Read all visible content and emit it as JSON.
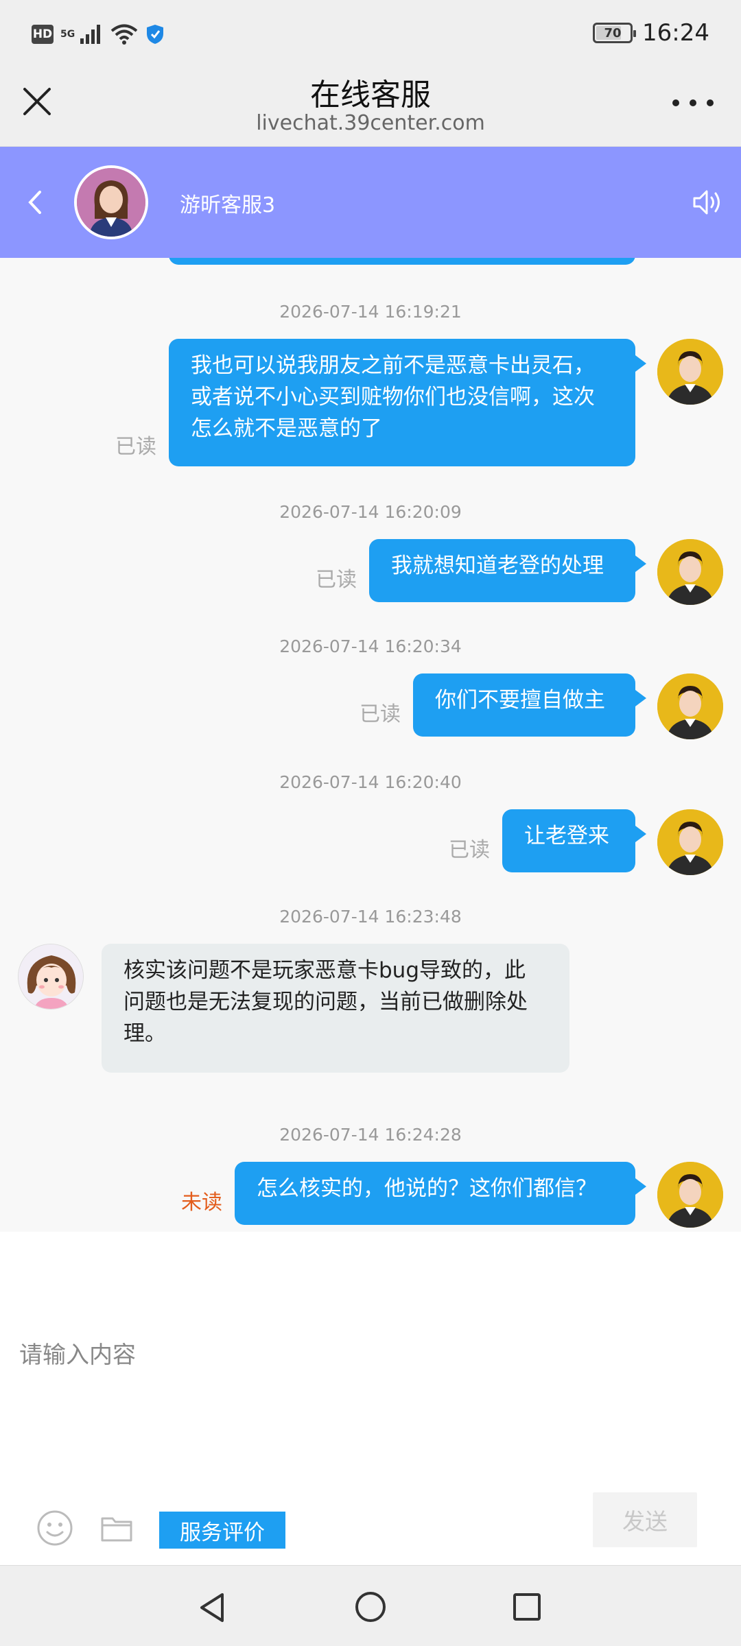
{
  "status_bar": {
    "network_label": "5G",
    "hd_label": "HD",
    "battery": "70",
    "time": "16:24"
  },
  "title_bar": {
    "title": "在线客服",
    "url": "livechat.39center.com"
  },
  "chat_header": {
    "agent_name": "游昕客服3"
  },
  "messages": [
    {
      "timestamp": "2026-07-14 16:19:21",
      "direction": "out",
      "text_lines": [
        "我也可以说我朋友之前不是恶意卡出灵石，",
        "或者说不小心买到赃物你们也没信啊，这次",
        "怎么就不是恶意的了"
      ],
      "status": "已读"
    },
    {
      "timestamp": "2026-07-14 16:20:09",
      "direction": "out",
      "text_lines": [
        "我就想知道老登的处理"
      ],
      "status": "已读"
    },
    {
      "timestamp": "2026-07-14 16:20:34",
      "direction": "out",
      "text_lines": [
        "你们不要擅自做主"
      ],
      "status": "已读"
    },
    {
      "timestamp": "2026-07-14 16:20:40",
      "direction": "out",
      "text_lines": [
        "让老登来"
      ],
      "status": "已读"
    },
    {
      "timestamp": "2026-07-14 16:23:48",
      "direction": "in",
      "text_lines": [
        "核实该问题不是玩家恶意卡bug导致的，此",
        "问题也是无法复现的问题，当前已做删除处",
        "理。"
      ]
    },
    {
      "timestamp": "2026-07-14 16:24:28",
      "direction": "out",
      "text_lines": [
        "怎么核实的，他说的？这你们都信？"
      ],
      "status": "未读"
    }
  ],
  "input": {
    "placeholder": "请输入内容",
    "value": ""
  },
  "toolbar": {
    "rate_label": "服务评价",
    "send_label": "发送"
  },
  "colors": {
    "header_bg": "#8c96ff",
    "bubble_out": "#1e9ff2",
    "bubble_in": "#e9edee",
    "unread": "#e35d1c"
  }
}
